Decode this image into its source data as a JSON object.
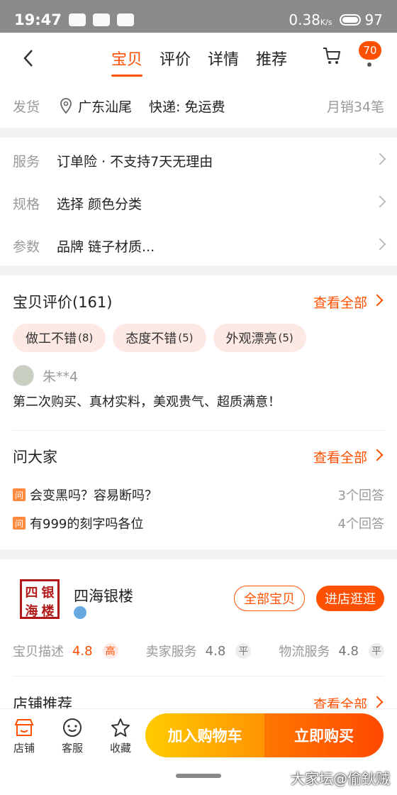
{
  "status_bar": {
    "time": "19:47",
    "network": "0.38",
    "network_unit": "K/s",
    "battery": "97"
  },
  "nav": {
    "tabs": [
      {
        "label": "宝贝",
        "active": true
      },
      {
        "label": "评价",
        "active": false
      },
      {
        "label": "详情",
        "active": false
      },
      {
        "label": "推荐",
        "active": false
      }
    ],
    "cart_badge": "70"
  },
  "shipping": {
    "label": "发货",
    "location": "广东汕尾",
    "express": "快递: 免运费",
    "monthly_sales": "月销34笔"
  },
  "service": {
    "items": [
      {
        "label": "服务",
        "value": "订单险 · 不支持7天无理由"
      },
      {
        "label": "规格",
        "value": "选择 颜色分类"
      },
      {
        "label": "参数",
        "value": "品牌 链子材质..."
      }
    ]
  },
  "reviews": {
    "title": "宝贝评价(161)",
    "see_all": "查看全部",
    "tags": [
      {
        "label": "做工不错",
        "count": "(8)"
      },
      {
        "label": "态度不错",
        "count": "(5)"
      },
      {
        "label": "外观漂亮",
        "count": "(5)"
      }
    ],
    "reviewer": "朱**4",
    "text": "第二次购买、真材实料，美观贵气、超质满意！"
  },
  "qa": {
    "title": "问大家",
    "see_all": "查看全部",
    "ask_icon_text": "问",
    "items": [
      {
        "question": "会变黑吗？容易断吗？",
        "answers": "3个回答"
      },
      {
        "question": "有999的刻字吗各位",
        "answers": "4个回答"
      }
    ]
  },
  "shop": {
    "logo_chars": [
      "四",
      "银",
      "海",
      "楼"
    ],
    "name": "四海银楼",
    "all_items_label": "全部宝贝",
    "enter_shop_label": "进店逛逛",
    "ratings": [
      {
        "label": "宝贝描述",
        "score": "4.8",
        "level": "高"
      },
      {
        "label": "卖家服务",
        "score": "4.8",
        "level": "平"
      },
      {
        "label": "物流服务",
        "score": "4.8",
        "level": "平"
      }
    ],
    "recommend_title": "店铺推荐",
    "recommend_see_all": "查看全部"
  },
  "bottom_bar": {
    "shop_label": "店铺",
    "service_label": "客服",
    "favorite_label": "收藏",
    "add_cart_label": "加入购物车",
    "buy_now_label": "立即购买"
  },
  "watermark": "大家坛@偷鈥贼",
  "colors": {
    "accent": "#ff5000",
    "cart_gradient_start": "#ffcb00",
    "buy_gradient_end": "#ff4900"
  }
}
